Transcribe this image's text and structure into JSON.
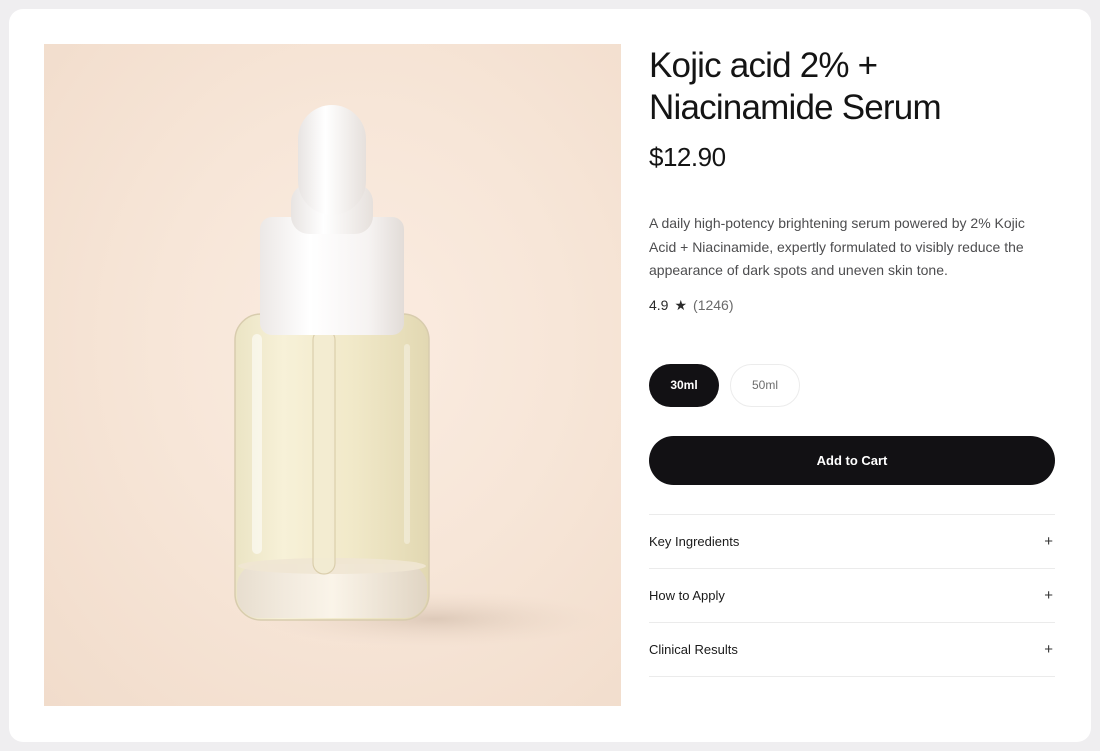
{
  "product": {
    "title": "Kojic acid 2% + Niacinamide Serum",
    "price": "$12.90",
    "description": "A daily high-potency brightening serum powered by 2% Kojic Acid + Niacinamide, expertly formulated to visibly reduce the appearance of dark spots and uneven skin tone.",
    "rating": "4.9",
    "rating_star": "★",
    "review_count": "(1246)",
    "image_alt": "Glass dropper bottle of serum"
  },
  "sizes": {
    "options": [
      "30ml",
      "50ml"
    ],
    "selected": "30ml"
  },
  "cart": {
    "label": "Add to Cart"
  },
  "accordion": {
    "items": [
      {
        "label": "Key Ingredients",
        "icon": "+"
      },
      {
        "label": "How to Apply",
        "icon": "+"
      },
      {
        "label": "Clinical Results",
        "icon": "+"
      }
    ]
  },
  "colors": {
    "accent": "#121114",
    "background": "#efeef0",
    "image_bg": "#f7e6d8"
  }
}
